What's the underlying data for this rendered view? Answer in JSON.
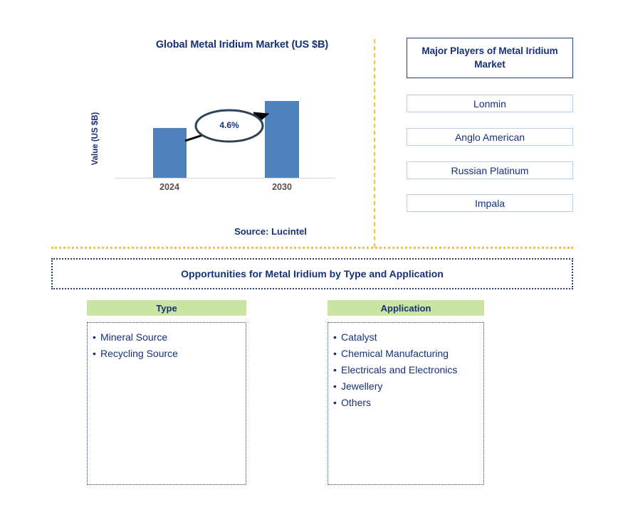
{
  "chart": {
    "title": "Global Metal Iridium Market (US $B)",
    "y_axis_label": "Value (US $B)",
    "cagr_label": "4.6%",
    "source": "Source: Lucintel"
  },
  "chart_data": {
    "type": "bar",
    "title": "Global Metal Iridium Market (US $B)",
    "categories": [
      "2024",
      "2030"
    ],
    "values": [
      58,
      90
    ],
    "value_unit": "US $B",
    "xlabel": "",
    "ylabel": "Value (US $B)",
    "ylim": [
      0,
      100
    ],
    "grid": false,
    "legend": "none",
    "bar_color": "#4f81bd",
    "annotations": [
      {
        "text": "4.6%",
        "type": "cagr-callout-ellipse-with-arrow",
        "from_category": "2024",
        "to_category": "2030"
      }
    ],
    "tick_labels": [
      "2024",
      "2030"
    ],
    "source": "Source: Lucintel"
  },
  "players_panel": {
    "header": "Major Players of Metal Iridium Market",
    "items": [
      {
        "label": "Lonmin"
      },
      {
        "label": "Anglo American"
      },
      {
        "label": "Russian Platinum"
      },
      {
        "label": "Impala"
      }
    ]
  },
  "opportunities": {
    "banner": "Opportunities for Metal Iridium by Type and Application",
    "columns": [
      {
        "header": "Type",
        "items": [
          "Mineral Source",
          "Recycling Source"
        ]
      },
      {
        "header": "Application",
        "items": [
          "Catalyst",
          "Chemical Manufacturing",
          "Electricals and Electronics",
          "Jewellery",
          "Others"
        ]
      }
    ]
  },
  "colors": {
    "navy": "#16307a",
    "bar_blue": "#4f81bd",
    "header_green": "#cae4a4",
    "divider_yellow": "#fbc531",
    "tick_gray": "#58504a"
  }
}
